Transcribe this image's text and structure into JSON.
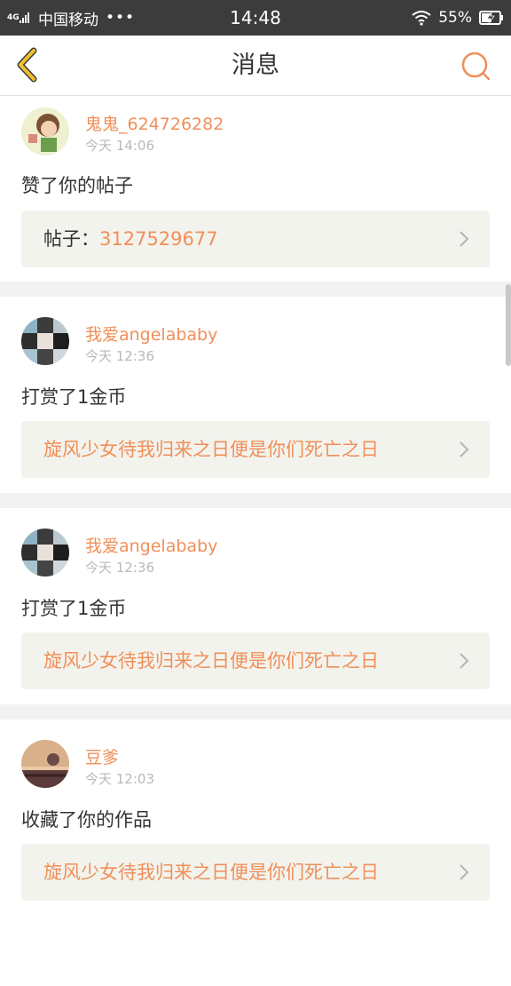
{
  "status_bar": {
    "network": "4G",
    "carrier": "中国移动",
    "dots": "•••",
    "time": "14:48",
    "battery": "55%"
  },
  "header": {
    "title": "消息",
    "back_icon": "chevron-left-icon",
    "search_icon": "search-icon"
  },
  "colors": {
    "accent": "#f08f59",
    "back_arrow": "#f0c12f",
    "status_bar_bg": "#3c3c3c",
    "link_box_bg": "#f3f3ed"
  },
  "messages": [
    {
      "username": "鬼鬼_624726282",
      "time": "今天 14:06",
      "action": "赞了你的帖子",
      "link_label": "帖子：",
      "link_value": "3127529677"
    },
    {
      "username": "我爱angelababy",
      "time": "今天 12:36",
      "action": "打赏了1金币",
      "link_value": "旋风少女待我归来之日便是你们死亡之日"
    },
    {
      "username": "我爱angelababy",
      "time": "今天 12:36",
      "action": "打赏了1金币",
      "link_value": "旋风少女待我归来之日便是你们死亡之日"
    },
    {
      "username": "豆爹",
      "time": "今天 12:03",
      "action": "收藏了你的作品",
      "link_value": "旋风少女待我归来之日便是你们死亡之日"
    }
  ]
}
